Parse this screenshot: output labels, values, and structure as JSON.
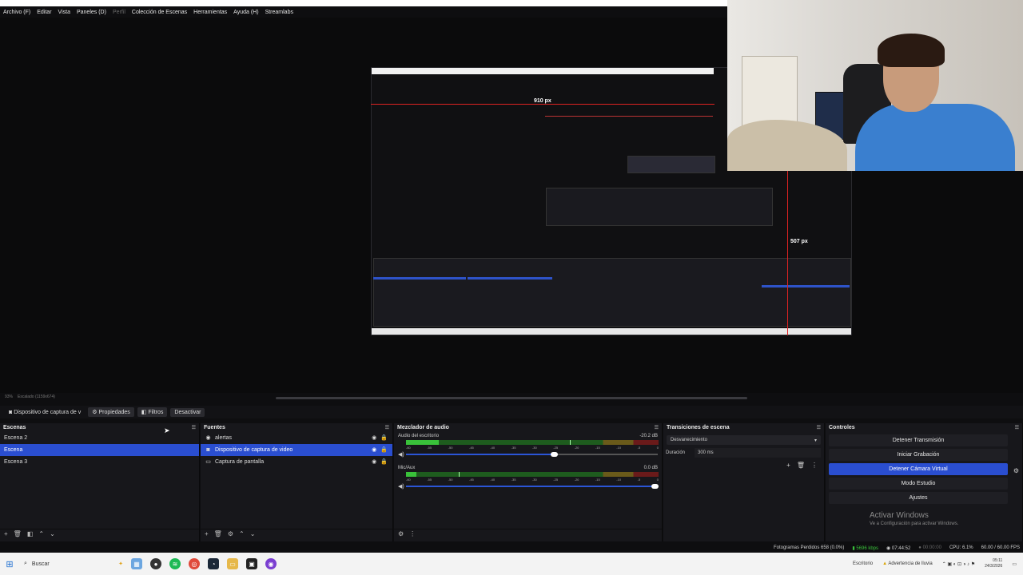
{
  "menu": {
    "items": [
      "Archivo (F)",
      "Editar",
      "Vista",
      "Paneles (D)",
      "Perfil",
      "Colección de Escenas",
      "Herramientas",
      "Ayuda (H)",
      "Streamlabs"
    ]
  },
  "preview": {
    "label_width": "910 px",
    "label_height": "507 px"
  },
  "zoom": {
    "percent": "93%",
    "scale_label": "Escalado (1159x674)"
  },
  "source_toolbar": {
    "selected_source": "Dispositivo de captura de v",
    "properties": "Propiedades",
    "filters": "Filtros",
    "deactivate": "Desactivar"
  },
  "scenes": {
    "title": "Escenas",
    "items": [
      {
        "label": "Escena 2",
        "selected": false
      },
      {
        "label": "Escena",
        "selected": true
      },
      {
        "label": "Escena 3",
        "selected": false
      }
    ]
  },
  "sources": {
    "title": "Fuentes",
    "items": [
      {
        "label": "alertas",
        "selected": false,
        "icon": "globe-icon"
      },
      {
        "label": "Dispositivo de captura de video",
        "selected": true,
        "icon": "camera-icon"
      },
      {
        "label": "Captura de pantalla",
        "selected": false,
        "icon": "monitor-icon"
      }
    ]
  },
  "mixer": {
    "title": "Mezclador de audio",
    "channels": [
      {
        "name": "Audio del escritorio",
        "db": "-20.2 dB",
        "level": 0.13,
        "volume": 0.6
      },
      {
        "name": "Mic/Aux",
        "db": "0.0 dB",
        "level": 0.04,
        "volume": 1.0
      }
    ],
    "ticks": [
      "-60",
      "-55",
      "-50",
      "-45",
      "-40",
      "-35",
      "-30",
      "-25",
      "-20",
      "-15",
      "-10",
      "-5",
      "0"
    ]
  },
  "transitions": {
    "title": "Transiciones de escena",
    "selected": "Desvanecimiento",
    "duration_label": "Duración",
    "duration_value": "300 ms"
  },
  "controls": {
    "title": "Controles",
    "buttons": [
      {
        "label": "Detener Transmisión",
        "active": false
      },
      {
        "label": "Iniciar Grabación",
        "active": false
      },
      {
        "label": "Detener Cámara Virtual",
        "active": true
      },
      {
        "label": "Modo Estudio",
        "active": false
      },
      {
        "label": "Ajustes",
        "active": false
      }
    ]
  },
  "watermark": {
    "line1": "Activar Windows",
    "line2": "Ve a Configuración para activar Windows."
  },
  "status": {
    "dropped_frames": "Fotogramas Perdidos 658 (0.0%)",
    "bitrate": "5696 kbps",
    "stream_time": "07:44:52",
    "rec_time": "00:00:00",
    "cpu": "CPU: 6.1%",
    "fps": "60.00 / 60.00 FPS"
  },
  "taskbar": {
    "search": "Buscar",
    "desktop": "Escritorio",
    "weather": "Advertencia de lluvia",
    "time": "05:11",
    "date": "24/3/2026"
  },
  "colors": {
    "accent": "#2a4ed0",
    "meter_green": "#39c13a",
    "guide_red": "#dd2222"
  }
}
